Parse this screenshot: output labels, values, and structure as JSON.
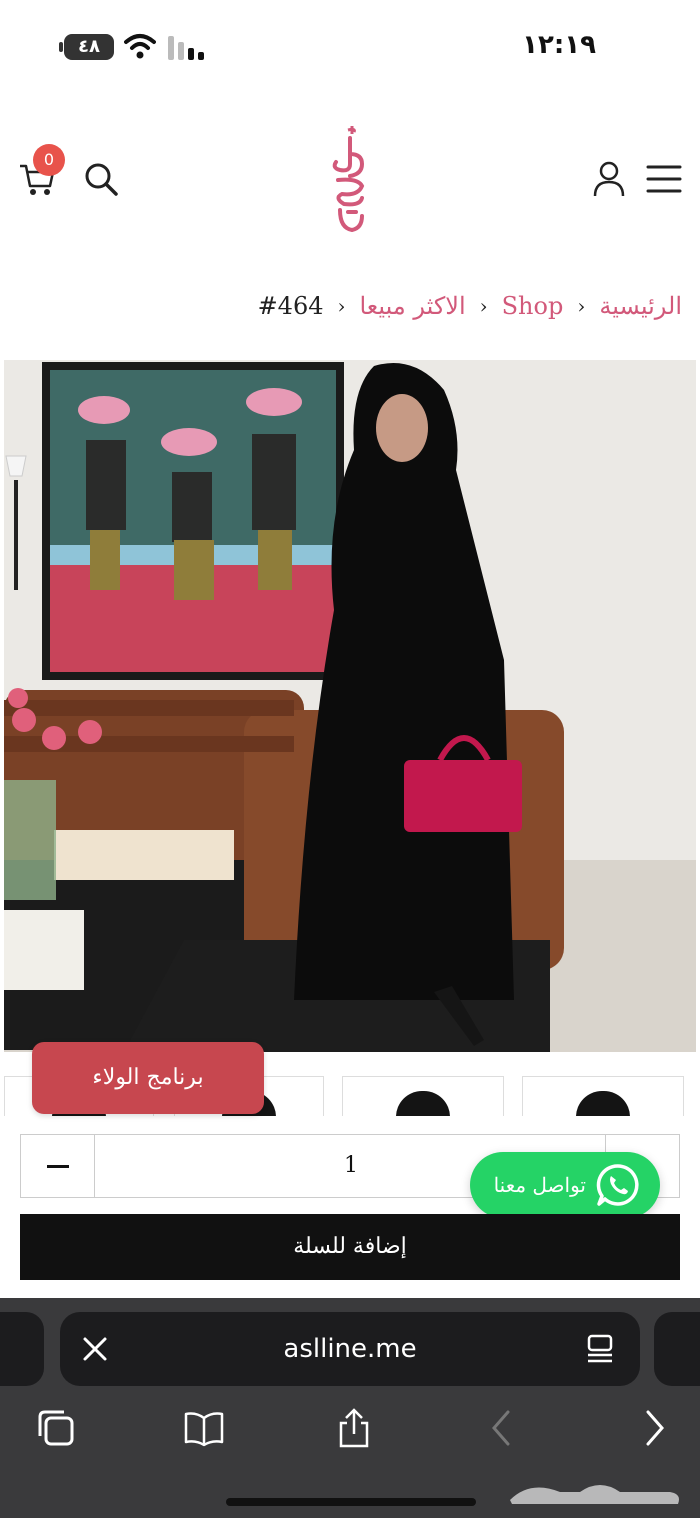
{
  "status_bar": {
    "time": "١٢:١٩",
    "battery": "٤٨"
  },
  "header": {
    "cart_count": "0"
  },
  "breadcrumb": {
    "home": "الرئيسية",
    "shop": "Shop",
    "category": "الاكثر مبيعا",
    "current": "#464"
  },
  "loyalty": {
    "label": "برنامج الولاء"
  },
  "quantity": {
    "value": "1"
  },
  "whatsapp": {
    "label": "تواصل معنا"
  },
  "add_to_cart": {
    "label": "إضافة للسلة"
  },
  "browser": {
    "url": "aslline.me"
  },
  "colors": {
    "accent_pink": "#d2597a",
    "loyalty_red": "#c7474f",
    "whatsapp_green": "#25d366",
    "cart_badge": "#e8534b"
  }
}
